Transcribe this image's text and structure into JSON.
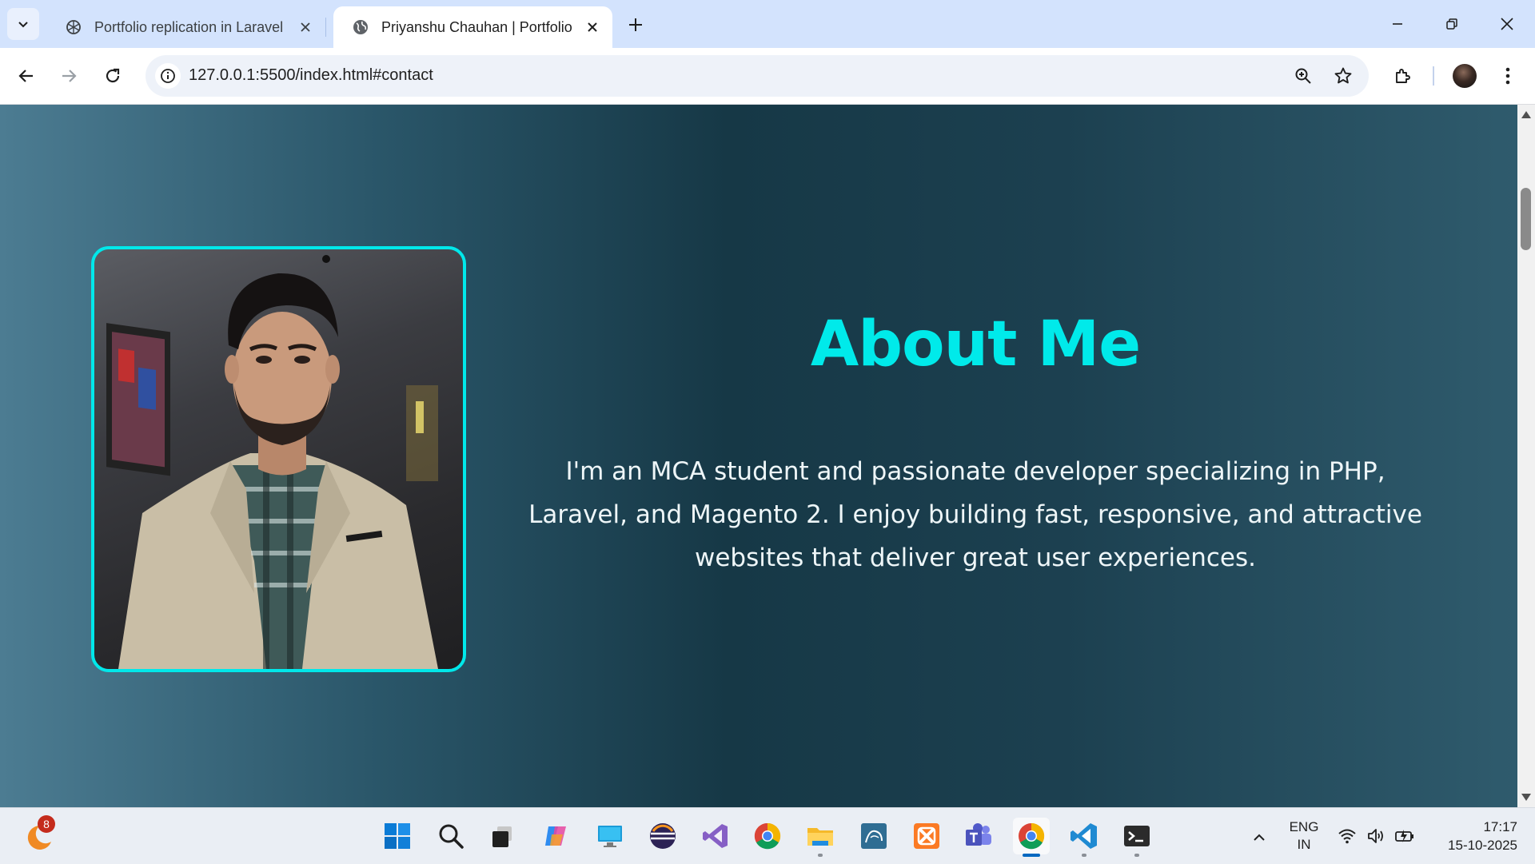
{
  "browser": {
    "tabs": [
      {
        "title": "Portfolio replication in Laravel",
        "active": false
      },
      {
        "title": "Priyanshu Chauhan | Portfolio",
        "active": true
      }
    ],
    "url": "127.0.0.1:5500/index.html#contact"
  },
  "page": {
    "about_title": "About Me",
    "about_text": "I'm an MCA student and passionate developer specializing in PHP, Laravel, and Magento 2. I enjoy building fast, responsive, and attractive websites that deliver great user experiences.",
    "accent_color": "#00eaea"
  },
  "taskbar": {
    "weather_badge": "8",
    "apps": [
      "start-icon",
      "search-icon",
      "task-view-icon",
      "copilot-icon",
      "remote-desktop-icon",
      "eclipse-icon",
      "visual-studio-icon",
      "chrome-icon",
      "file-explorer-icon",
      "mysql-workbench-icon",
      "xampp-icon",
      "teams-icon",
      "chrome-icon",
      "vscode-icon",
      "terminal-icon"
    ],
    "language": {
      "line1": "ENG",
      "line2": "IN"
    },
    "time": "17:17",
    "date": "15-10-2025"
  }
}
